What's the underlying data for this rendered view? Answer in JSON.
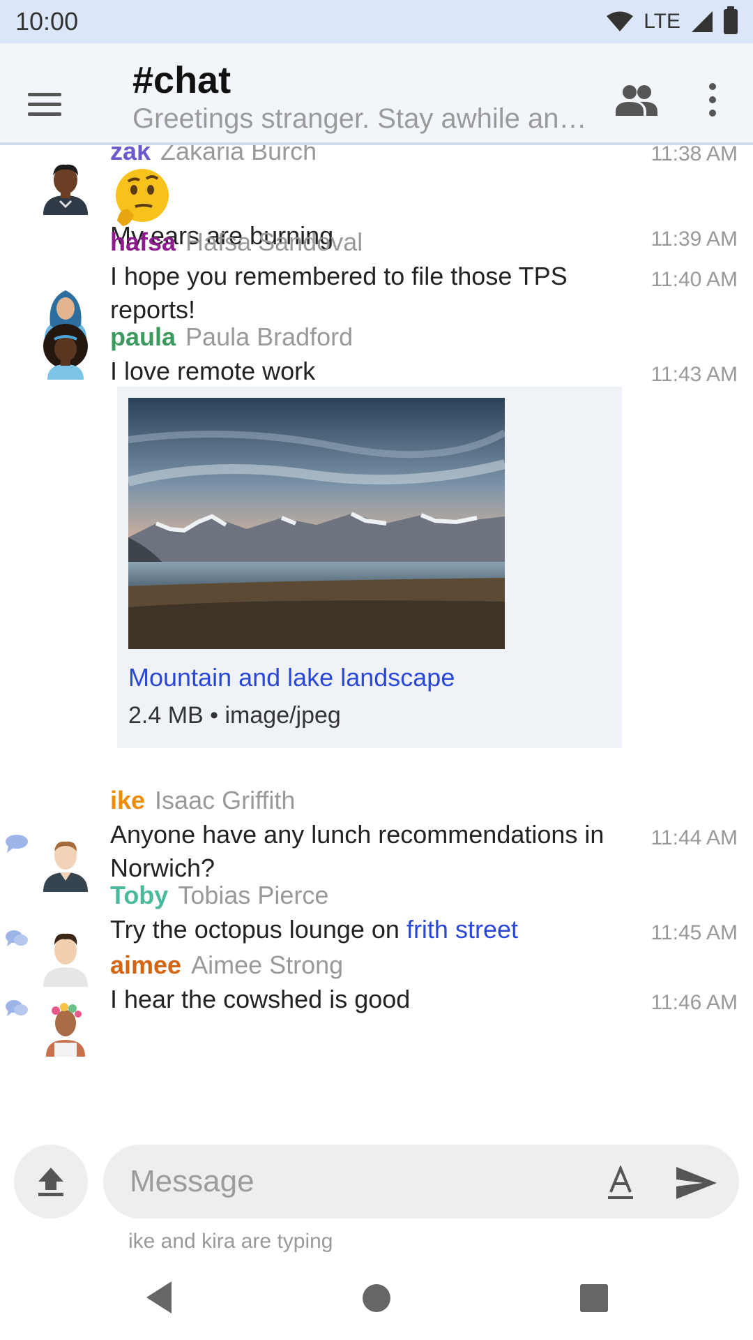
{
  "status": {
    "time": "10:00",
    "network": "LTE"
  },
  "header": {
    "channel": "#chat",
    "topic": "Greetings stranger. Stay awhile and listen.",
    "topic_display": "Greetings stranger. Stay awhile an…"
  },
  "messages": [
    {
      "nick": "zak",
      "full_name": "Zakaria Burch",
      "nick_color": "#6a5acd",
      "emoji": "thinking-face",
      "text": "",
      "time": "11:38 AM"
    },
    {
      "nick": "",
      "full_name": "",
      "text": "My ears are burning",
      "time": "11:39 AM"
    },
    {
      "nick": "hafsa",
      "full_name": "Hafsa Sandoval",
      "nick_color": "#8e1b8e",
      "text": "I hope you remembered to file those TPS reports!",
      "time": "11:40 AM"
    },
    {
      "nick": "paula",
      "full_name": "Paula Bradford",
      "nick_color": "#3c9a5f",
      "text": "I love remote work",
      "time": "11:43 AM",
      "attachment": {
        "title": "Mountain and lake landscape",
        "meta": "2.4 MB • image/jpeg"
      }
    },
    {
      "nick": "ike",
      "full_name": "Isaac Griffith",
      "nick_color": "#f08c00",
      "text": "Anyone have any lunch recommendations in Norwich?",
      "time": "11:44 AM"
    },
    {
      "nick": "Toby",
      "full_name": "Tobias Pierce",
      "nick_color": "#4bb99b",
      "text_before": "Try the octopus lounge on ",
      "link": "frith street",
      "time": "11:45 AM"
    },
    {
      "nick": "aimee",
      "full_name": "Aimee Strong",
      "nick_color": "#d4640f",
      "text": "I hear the cowshed is good",
      "time": "11:46 AM"
    }
  ],
  "composer": {
    "placeholder": "Message",
    "typing": "ike and kira are typing"
  },
  "colors": {
    "status_bar": "#dbe7f8",
    "app_bar": "#f2f6fb",
    "link": "#2b47d8",
    "attachment_bg": "#eff3f8"
  }
}
